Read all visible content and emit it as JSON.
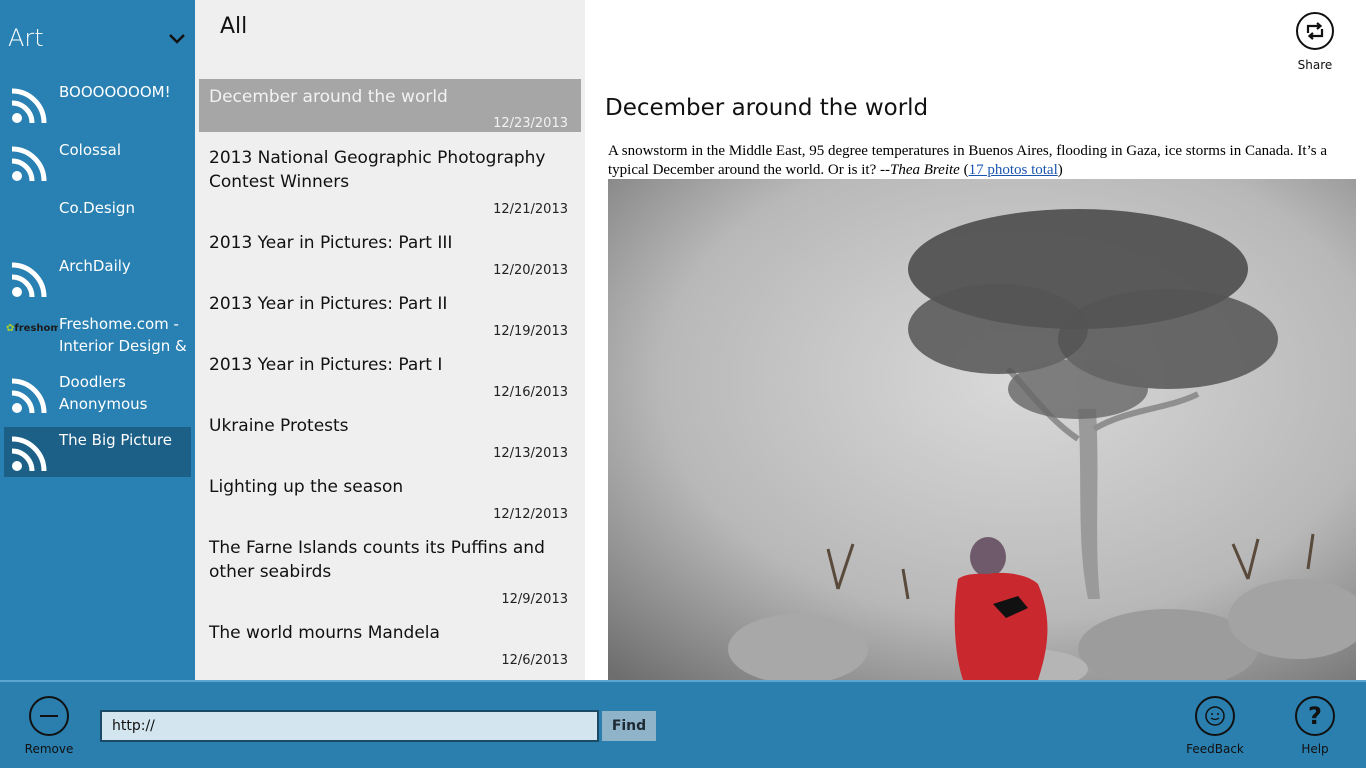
{
  "sidebar": {
    "category": "Art",
    "feeds": [
      {
        "title": "BOOOOOOOM!",
        "icon": "rss-icon"
      },
      {
        "title": "Colossal",
        "icon": "rss-icon"
      },
      {
        "title": "Co.Design",
        "icon": "none"
      },
      {
        "title": "ArchDaily",
        "icon": "rss-icon"
      },
      {
        "title": "Freshome.com - Interior Design & Architecture",
        "icon": "freshome-logo",
        "logo_text": "freshome"
      },
      {
        "title": "Doodlers Anonymous",
        "icon": "rss-icon"
      },
      {
        "title": "The Big Picture",
        "icon": "rss-icon",
        "selected": true
      }
    ]
  },
  "list": {
    "title": "All",
    "articles": [
      {
        "title": "December around the world",
        "date": "12/23/2013",
        "selected": true
      },
      {
        "title": "2013 National Geographic Photography Contest Winners",
        "date": "12/21/2013"
      },
      {
        "title": "2013 Year in Pictures: Part III",
        "date": "12/20/2013"
      },
      {
        "title": "2013 Year in Pictures: Part II",
        "date": "12/19/2013"
      },
      {
        "title": "2013 Year in Pictures: Part I",
        "date": "12/16/2013"
      },
      {
        "title": "Ukraine Protests",
        "date": "12/13/2013"
      },
      {
        "title": "Lighting up the season",
        "date": "12/12/2013"
      },
      {
        "title": "The Farne Islands counts its Puffins and other seabirds",
        "date": "12/9/2013"
      },
      {
        "title": "The world mourns Mandela",
        "date": "12/6/2013"
      }
    ]
  },
  "reader": {
    "share_label": "Share",
    "heading": "December around the world",
    "body_text": "A snowstorm in the Middle East, 95 degree temperatures in Buenos Aires, flooding in Gaza, ice storms in Canada. It’s a typical December around the world. Or is it? --",
    "author": "Thea Breite",
    "link_text": "17 photos total",
    "photo_icon": "snow-reindeer-photo"
  },
  "appbar": {
    "remove_label": "Remove",
    "url_value": "http://",
    "find_label": "Find",
    "feedback_label": "FeedBack",
    "help_label": "Help"
  },
  "colors": {
    "sidebar": "#2980b2",
    "sidebar_selected": "#1c5f87",
    "list_bg": "#efefef",
    "list_selected": "#a6a6a6",
    "appbar": "#2a7fae"
  }
}
